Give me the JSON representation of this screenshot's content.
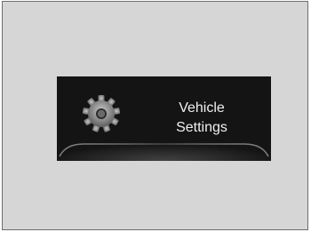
{
  "menu": {
    "title_line1": "Vehicle",
    "title_line2": "Settings",
    "icon": "gear-icon"
  },
  "colors": {
    "frame_background": "#d6d6d6",
    "panel_background": "#141414",
    "label_color": "#f0f0f0"
  }
}
